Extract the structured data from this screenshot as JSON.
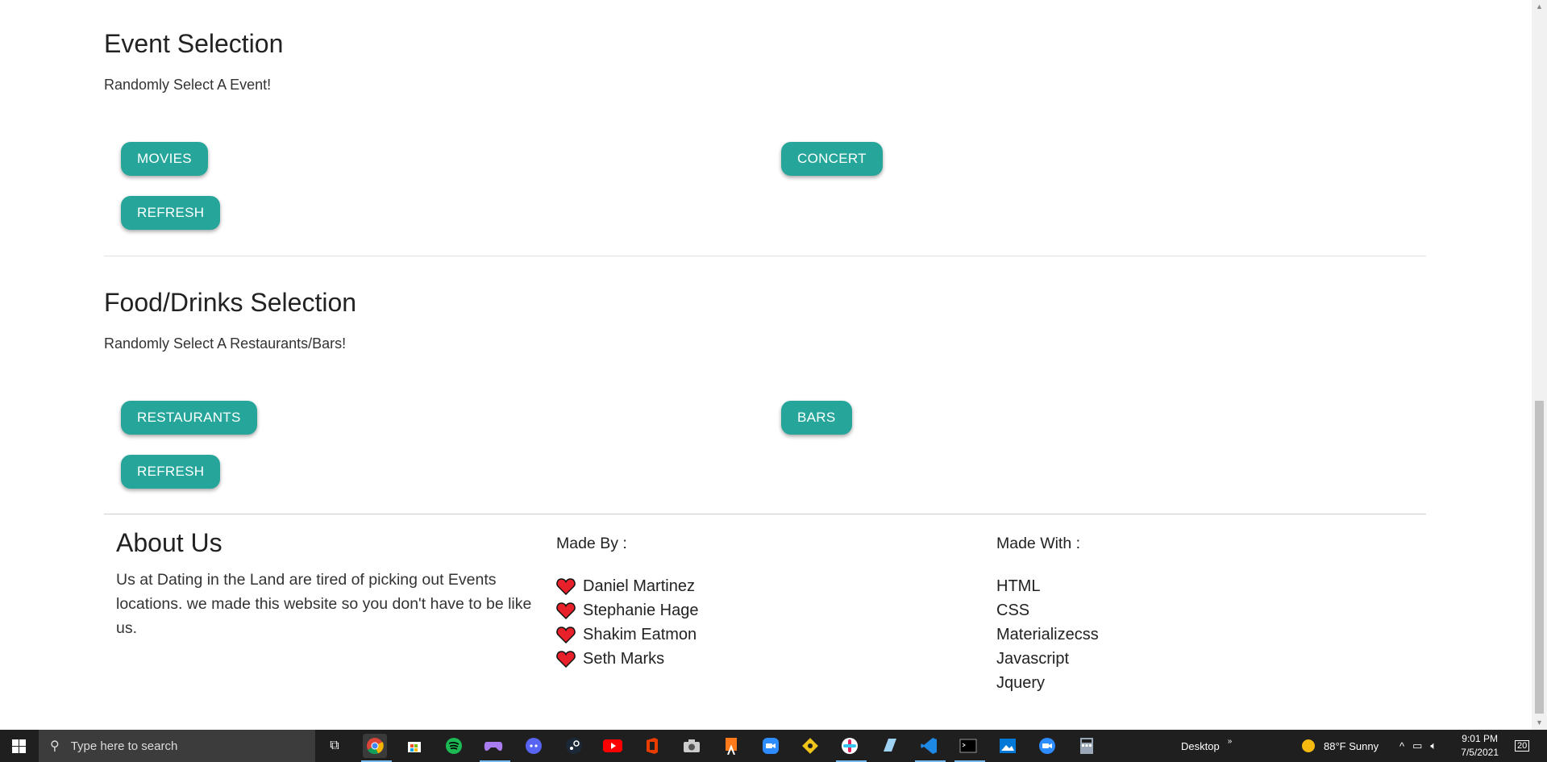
{
  "event_section": {
    "title": "Event Selection",
    "subtitle": "Randomly Select A Event!",
    "buttons": {
      "movies": "MOVIES",
      "concert": "CONCERT",
      "refresh": "REFRESH"
    }
  },
  "food_section": {
    "title": "Food/Drinks Selection",
    "subtitle": "Randomly Select A Restaurants/Bars!",
    "buttons": {
      "restaurants": "RESTAURANTS",
      "bars": "BARS",
      "refresh": "REFRESH"
    }
  },
  "footer": {
    "about": {
      "title": "About Us",
      "text": "Us at Dating in the Land are tired of picking out Events locations. we made this website so you don't have to be like us."
    },
    "made_by": {
      "heading": "Made By :",
      "people": [
        "Daniel Martinez",
        "Stephanie Hage",
        "Shakim Eatmon",
        "Seth Marks"
      ]
    },
    "made_with": {
      "heading": "Made With :",
      "tech": [
        "HTML",
        "CSS",
        "Materializecss",
        "Javascript",
        "Jquery"
      ]
    }
  },
  "colors": {
    "button": "#26a69a",
    "heart": "#e8202a",
    "taskbar": "#1f1f1f"
  },
  "taskbar": {
    "search_placeholder": "Type here to search",
    "apps": [
      "task-view-icon",
      "chrome-icon",
      "store-icon",
      "spotify-icon",
      "game-controller-icon",
      "discord-icon",
      "steam-icon",
      "youtube-icon",
      "office-icon",
      "camera-icon",
      "snipping-tool-icon",
      "zoom-icon",
      "git-icon",
      "slack-icon",
      "notepad-icon",
      "vscode-icon",
      "terminal-icon",
      "photos-icon",
      "zoom-meeting-icon",
      "calculator-icon"
    ],
    "desktop_label": "Desktop",
    "weather": "88°F  Sunny",
    "time": "9:01 PM",
    "date": "7/5/2021",
    "notification_count": "20"
  }
}
